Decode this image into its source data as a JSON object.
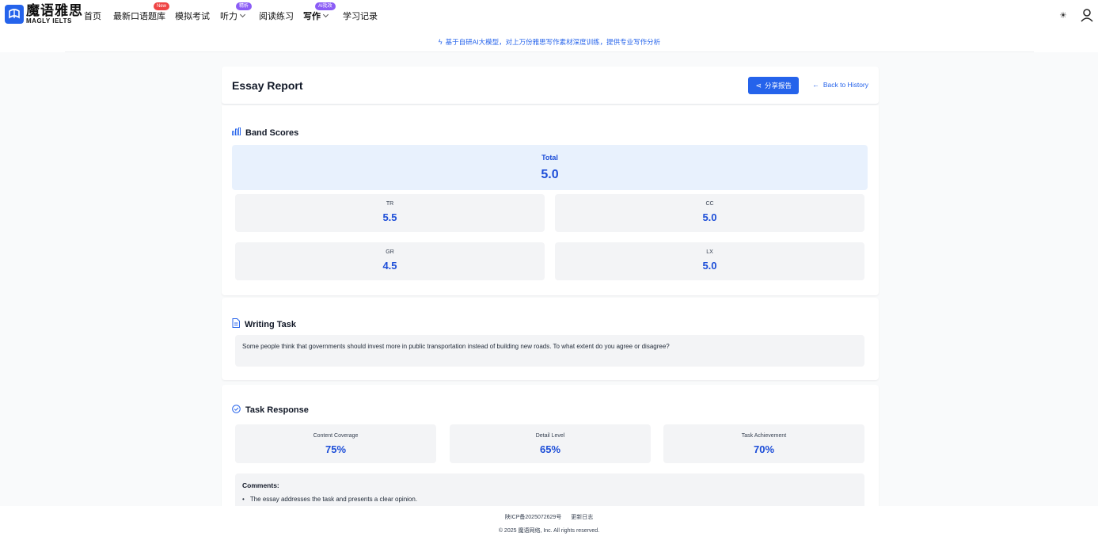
{
  "nav": {
    "logo_cn": "魔语雅思",
    "logo_en": "MAGLY IELTS",
    "items": [
      {
        "label": "首页"
      },
      {
        "label": "最新口语题库",
        "badge": "New"
      },
      {
        "label": "模拟考试"
      },
      {
        "label": "听力",
        "badge": "精析"
      },
      {
        "label": "阅读练习"
      },
      {
        "label": "写作",
        "badge": "AI批改"
      },
      {
        "label": "学习记录"
      }
    ],
    "theme_icon": "sun-icon",
    "user_icon": "user-icon"
  },
  "announcement": {
    "icon": "lightning-icon",
    "text": "基于自研AI大模型，对上万份雅思写作素材深度训练，提供专业写作分析"
  },
  "report": {
    "title": "Essay Report",
    "share_label": "分享报告",
    "back_label": "Back to History"
  },
  "band_scores": {
    "title": "Band Scores",
    "total_label": "Total",
    "total_value": "5.0",
    "items": [
      {
        "label": "TR",
        "value": "5.5"
      },
      {
        "label": "CC",
        "value": "5.0"
      },
      {
        "label": "GR",
        "value": "4.5"
      },
      {
        "label": "LX",
        "value": "5.0"
      }
    ]
  },
  "writing_task": {
    "title": "Writing Task",
    "prompt": "Some people think that governments should invest more in public transportation instead of building new roads. To what extent do you agree or disagree?"
  },
  "task_response": {
    "title": "Task Response",
    "metrics": [
      {
        "label": "Content Coverage",
        "value": "75%"
      },
      {
        "label": "Detail Level",
        "value": "65%"
      },
      {
        "label": "Task Achievement",
        "value": "70%"
      }
    ],
    "comments_title": "Comments:",
    "comments": [
      "The essay addresses the task and presents a clear opinion."
    ]
  },
  "footer": {
    "icp": "陕ICP备2025072629号",
    "changelog": "更新日志",
    "copyright": "© 2025 魔语网络, Inc. All rights reserved."
  },
  "colors": {
    "accent": "#2563eb",
    "badge_new": "#ef4444",
    "badge_ai": "#8b5cf6",
    "total_bg": "#e8f1fd"
  }
}
